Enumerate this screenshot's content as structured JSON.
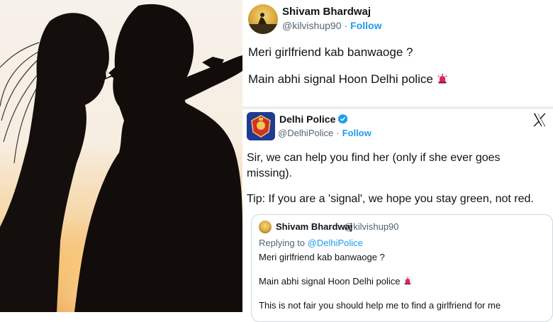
{
  "top_tweet": {
    "name": "Shivam Bhardwaj",
    "handle": "@kilvishup90",
    "separator": "·",
    "follow_label": "Follow",
    "line1": "Meri girlfriend kab banwaoge ?",
    "line2": "Main abhi signal Hoon Delhi police",
    "emoji": "siren-icon"
  },
  "police_tweet": {
    "name": "Delhi Police",
    "handle": "@DelhiPolice",
    "separator": "·",
    "follow_label": "Follow",
    "verified_icon": "verified-badge-icon",
    "logo_icon": "x-logo-icon",
    "body_line1": "Sir, we can help you find her (only if she ever goes",
    "body_line2": "missing).",
    "body_line3": "Tip: If you are a 'signal', we hope you stay green, not red."
  },
  "quoted_tweet": {
    "name": "Shivam Bhardwaj",
    "handle": "@kilvishup90",
    "replying_prefix": "Replying to ",
    "replying_to": "@DelhiPolice",
    "line1": "Meri girlfriend kab banwaoge ?",
    "line2": "Main abhi signal Hoon Delhi police",
    "line3": "This is not fair you should help me to find a girlfriend for me"
  },
  "colors": {
    "link_blue": "#1d9bf0",
    "muted_text": "#536471",
    "police_blue": "#1f3a93",
    "sunset_orange": "#e07a1f"
  }
}
